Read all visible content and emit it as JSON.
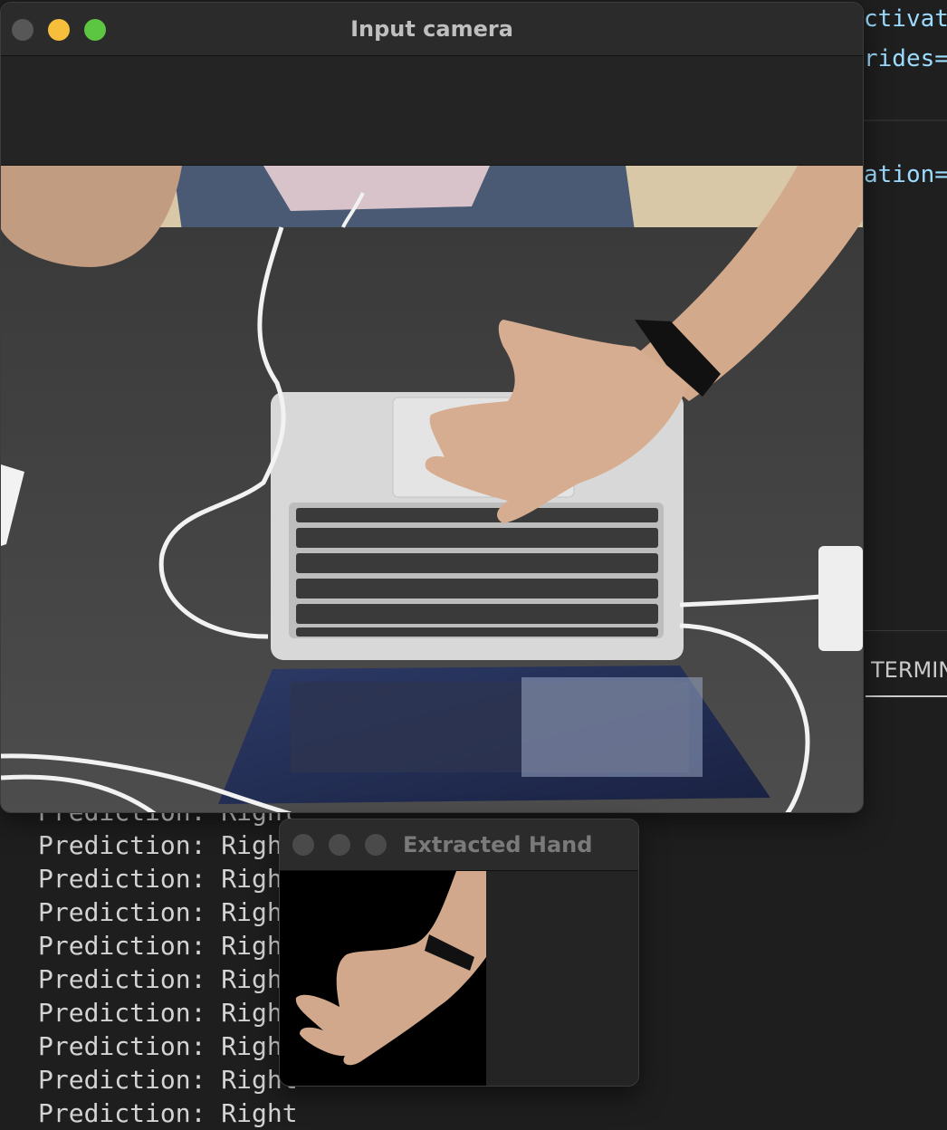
{
  "editor": {
    "code_lines": [
      "ctivat",
      "rides=",
      "ation="
    ],
    "terminal_tab": "TERMINAL",
    "terminal_lines": [
      "Prediction: Right",
      "Prediction: Right",
      "Prediction: Right",
      "Prediction: Right",
      "Prediction: Right",
      "Prediction: Right",
      "Prediction: Right",
      "Prediction: Right",
      "Prediction: Right",
      "Prediction: Right"
    ]
  },
  "camera_window": {
    "title": "Input camera",
    "traffic_colors": {
      "close": "#575757",
      "minimize": "#f6be3b",
      "zoom": "#5cc541"
    }
  },
  "hand_window": {
    "title": "Extracted Hand"
  }
}
